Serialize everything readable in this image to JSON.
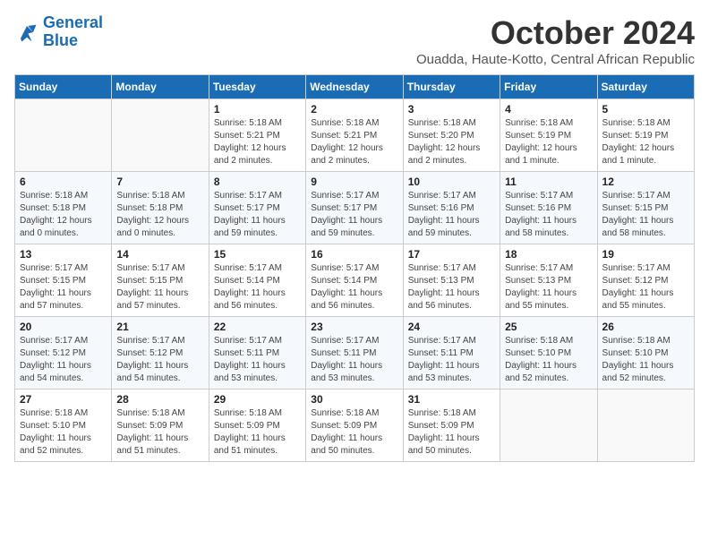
{
  "logo": {
    "text_general": "General",
    "text_blue": "Blue"
  },
  "header": {
    "month_year": "October 2024",
    "location": "Ouadda, Haute-Kotto, Central African Republic"
  },
  "weekdays": [
    "Sunday",
    "Monday",
    "Tuesday",
    "Wednesday",
    "Thursday",
    "Friday",
    "Saturday"
  ],
  "weeks": [
    [
      {
        "day": "",
        "info": ""
      },
      {
        "day": "",
        "info": ""
      },
      {
        "day": "1",
        "info": "Sunrise: 5:18 AM\nSunset: 5:21 PM\nDaylight: 12 hours and 2 minutes."
      },
      {
        "day": "2",
        "info": "Sunrise: 5:18 AM\nSunset: 5:21 PM\nDaylight: 12 hours and 2 minutes."
      },
      {
        "day": "3",
        "info": "Sunrise: 5:18 AM\nSunset: 5:20 PM\nDaylight: 12 hours and 2 minutes."
      },
      {
        "day": "4",
        "info": "Sunrise: 5:18 AM\nSunset: 5:19 PM\nDaylight: 12 hours and 1 minute."
      },
      {
        "day": "5",
        "info": "Sunrise: 5:18 AM\nSunset: 5:19 PM\nDaylight: 12 hours and 1 minute."
      }
    ],
    [
      {
        "day": "6",
        "info": "Sunrise: 5:18 AM\nSunset: 5:18 PM\nDaylight: 12 hours and 0 minutes."
      },
      {
        "day": "7",
        "info": "Sunrise: 5:18 AM\nSunset: 5:18 PM\nDaylight: 12 hours and 0 minutes."
      },
      {
        "day": "8",
        "info": "Sunrise: 5:17 AM\nSunset: 5:17 PM\nDaylight: 11 hours and 59 minutes."
      },
      {
        "day": "9",
        "info": "Sunrise: 5:17 AM\nSunset: 5:17 PM\nDaylight: 11 hours and 59 minutes."
      },
      {
        "day": "10",
        "info": "Sunrise: 5:17 AM\nSunset: 5:16 PM\nDaylight: 11 hours and 59 minutes."
      },
      {
        "day": "11",
        "info": "Sunrise: 5:17 AM\nSunset: 5:16 PM\nDaylight: 11 hours and 58 minutes."
      },
      {
        "day": "12",
        "info": "Sunrise: 5:17 AM\nSunset: 5:15 PM\nDaylight: 11 hours and 58 minutes."
      }
    ],
    [
      {
        "day": "13",
        "info": "Sunrise: 5:17 AM\nSunset: 5:15 PM\nDaylight: 11 hours and 57 minutes."
      },
      {
        "day": "14",
        "info": "Sunrise: 5:17 AM\nSunset: 5:15 PM\nDaylight: 11 hours and 57 minutes."
      },
      {
        "day": "15",
        "info": "Sunrise: 5:17 AM\nSunset: 5:14 PM\nDaylight: 11 hours and 56 minutes."
      },
      {
        "day": "16",
        "info": "Sunrise: 5:17 AM\nSunset: 5:14 PM\nDaylight: 11 hours and 56 minutes."
      },
      {
        "day": "17",
        "info": "Sunrise: 5:17 AM\nSunset: 5:13 PM\nDaylight: 11 hours and 56 minutes."
      },
      {
        "day": "18",
        "info": "Sunrise: 5:17 AM\nSunset: 5:13 PM\nDaylight: 11 hours and 55 minutes."
      },
      {
        "day": "19",
        "info": "Sunrise: 5:17 AM\nSunset: 5:12 PM\nDaylight: 11 hours and 55 minutes."
      }
    ],
    [
      {
        "day": "20",
        "info": "Sunrise: 5:17 AM\nSunset: 5:12 PM\nDaylight: 11 hours and 54 minutes."
      },
      {
        "day": "21",
        "info": "Sunrise: 5:17 AM\nSunset: 5:12 PM\nDaylight: 11 hours and 54 minutes."
      },
      {
        "day": "22",
        "info": "Sunrise: 5:17 AM\nSunset: 5:11 PM\nDaylight: 11 hours and 53 minutes."
      },
      {
        "day": "23",
        "info": "Sunrise: 5:17 AM\nSunset: 5:11 PM\nDaylight: 11 hours and 53 minutes."
      },
      {
        "day": "24",
        "info": "Sunrise: 5:17 AM\nSunset: 5:11 PM\nDaylight: 11 hours and 53 minutes."
      },
      {
        "day": "25",
        "info": "Sunrise: 5:18 AM\nSunset: 5:10 PM\nDaylight: 11 hours and 52 minutes."
      },
      {
        "day": "26",
        "info": "Sunrise: 5:18 AM\nSunset: 5:10 PM\nDaylight: 11 hours and 52 minutes."
      }
    ],
    [
      {
        "day": "27",
        "info": "Sunrise: 5:18 AM\nSunset: 5:10 PM\nDaylight: 11 hours and 52 minutes."
      },
      {
        "day": "28",
        "info": "Sunrise: 5:18 AM\nSunset: 5:09 PM\nDaylight: 11 hours and 51 minutes."
      },
      {
        "day": "29",
        "info": "Sunrise: 5:18 AM\nSunset: 5:09 PM\nDaylight: 11 hours and 51 minutes."
      },
      {
        "day": "30",
        "info": "Sunrise: 5:18 AM\nSunset: 5:09 PM\nDaylight: 11 hours and 50 minutes."
      },
      {
        "day": "31",
        "info": "Sunrise: 5:18 AM\nSunset: 5:09 PM\nDaylight: 11 hours and 50 minutes."
      },
      {
        "day": "",
        "info": ""
      },
      {
        "day": "",
        "info": ""
      }
    ]
  ]
}
